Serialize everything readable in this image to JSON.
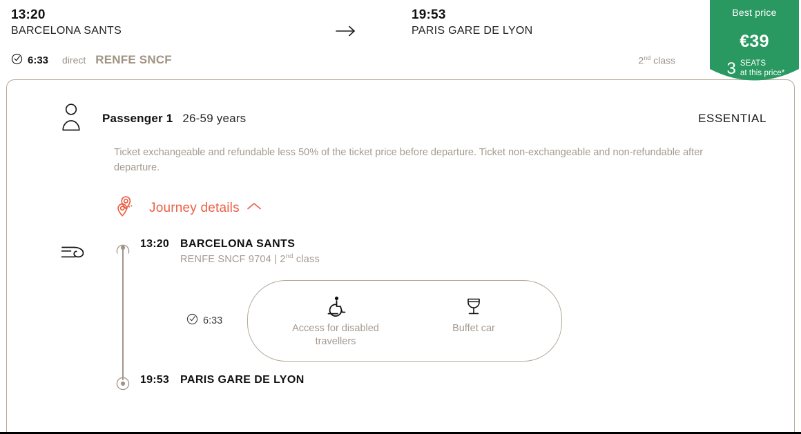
{
  "summary": {
    "departure": {
      "time": "13:20",
      "station": "BARCELONA SANTS"
    },
    "arrival": {
      "time": "19:53",
      "station": "PARIS GARE DE LYON"
    },
    "arrow_icon": "arrow-right-icon",
    "duration": "6:33",
    "duration_icon": "clock-icon",
    "stops": "direct",
    "carrier": "RENFE SNCF",
    "class_number": "2",
    "class_ordinal": "nd",
    "class_word": "class"
  },
  "badge": {
    "title": "Best price",
    "price": "€39",
    "seats_count": "3",
    "seats_label_line1": "SEATS",
    "seats_label_line2": "at this price*",
    "color": "#2a9961"
  },
  "passenger": {
    "icon": "person-icon",
    "label": "Passenger 1",
    "age": "26-59 years",
    "fare": "ESSENTIAL",
    "conditions": "Ticket exchangeable and refundable less 50% of the ticket price before departure. Ticket non-exchangeable and non-refundable after departure."
  },
  "journey_details": {
    "label": "Journey details",
    "pins_icon": "map-pins-icon",
    "chevron_icon": "chevron-up-icon",
    "expanded": true,
    "color": "#ec5f45"
  },
  "timeline": {
    "mode_icon": "train-icon",
    "departure": {
      "time": "13:20",
      "station": "BARCELONA SANTS",
      "carrier": "RENFE SNCF",
      "train_number": "9704",
      "separator": "|",
      "class_number": "2",
      "class_ordinal": "nd",
      "class_word": "class"
    },
    "leg_duration": "6:33",
    "leg_duration_icon": "clock-icon",
    "amenities": [
      {
        "icon": "wheelchair-icon",
        "label": "Access for disabled travellers"
      },
      {
        "icon": "wine-glass-icon",
        "label": "Buffet car"
      }
    ],
    "arrival": {
      "time": "19:53",
      "station": "PARIS GARE DE LYON"
    }
  }
}
